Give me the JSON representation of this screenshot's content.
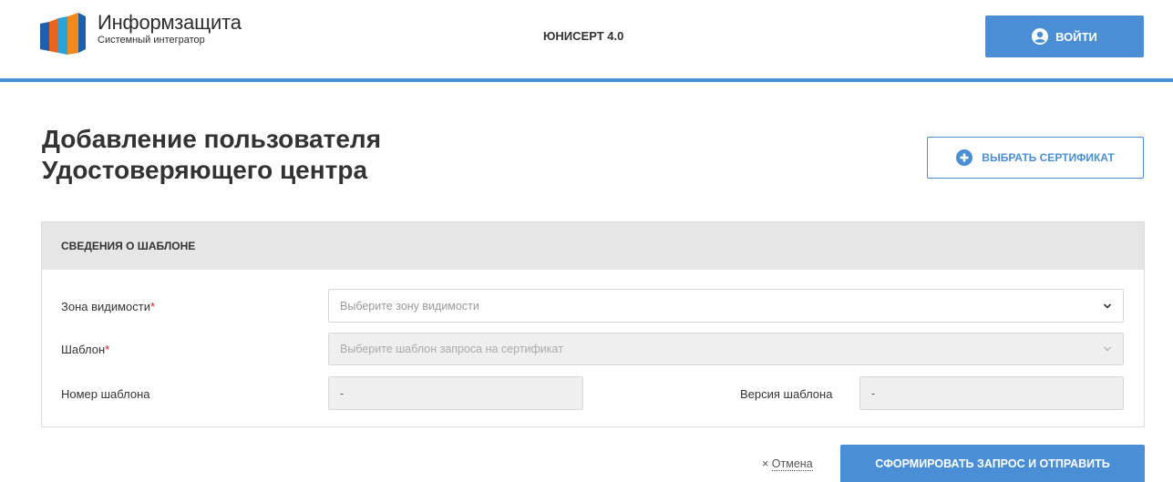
{
  "header": {
    "brand_name": "Информзащита",
    "brand_sub": "Системный интегратор",
    "product": "ЮНИСЕРТ 4.0",
    "login_label": "ВОЙТИ",
    "accent": "#4a8fd6"
  },
  "page": {
    "title_line1": "Добавление пользователя",
    "title_line2": "Удостоверяющего центра",
    "choose_cert_label": "ВЫБРАТЬ СЕРТИФИКАТ"
  },
  "panel": {
    "heading": "СВЕДЕНИЯ О ШАБЛОНЕ",
    "zone_label": "Зона видимости",
    "zone_placeholder": "Выберите зону видимости",
    "template_label": "Шаблон",
    "template_placeholder": "Выберите шаблон запроса на сертификат",
    "required_mark": "*",
    "template_number_label": "Номер шаблона",
    "template_number_value": "-",
    "template_version_label": "Версия шаблона",
    "template_version_value": "-"
  },
  "actions": {
    "cancel_icon": "×",
    "cancel_label": "Отмена",
    "submit_label": "СФОРМИРОВАТЬ ЗАПРОС И ОТПРАВИТЬ"
  },
  "icons": {
    "logo": "informzashchita-logo",
    "login": "user-circle-icon",
    "choose": "plus-circle-icon",
    "dropdown": "chevron-down-icon"
  }
}
